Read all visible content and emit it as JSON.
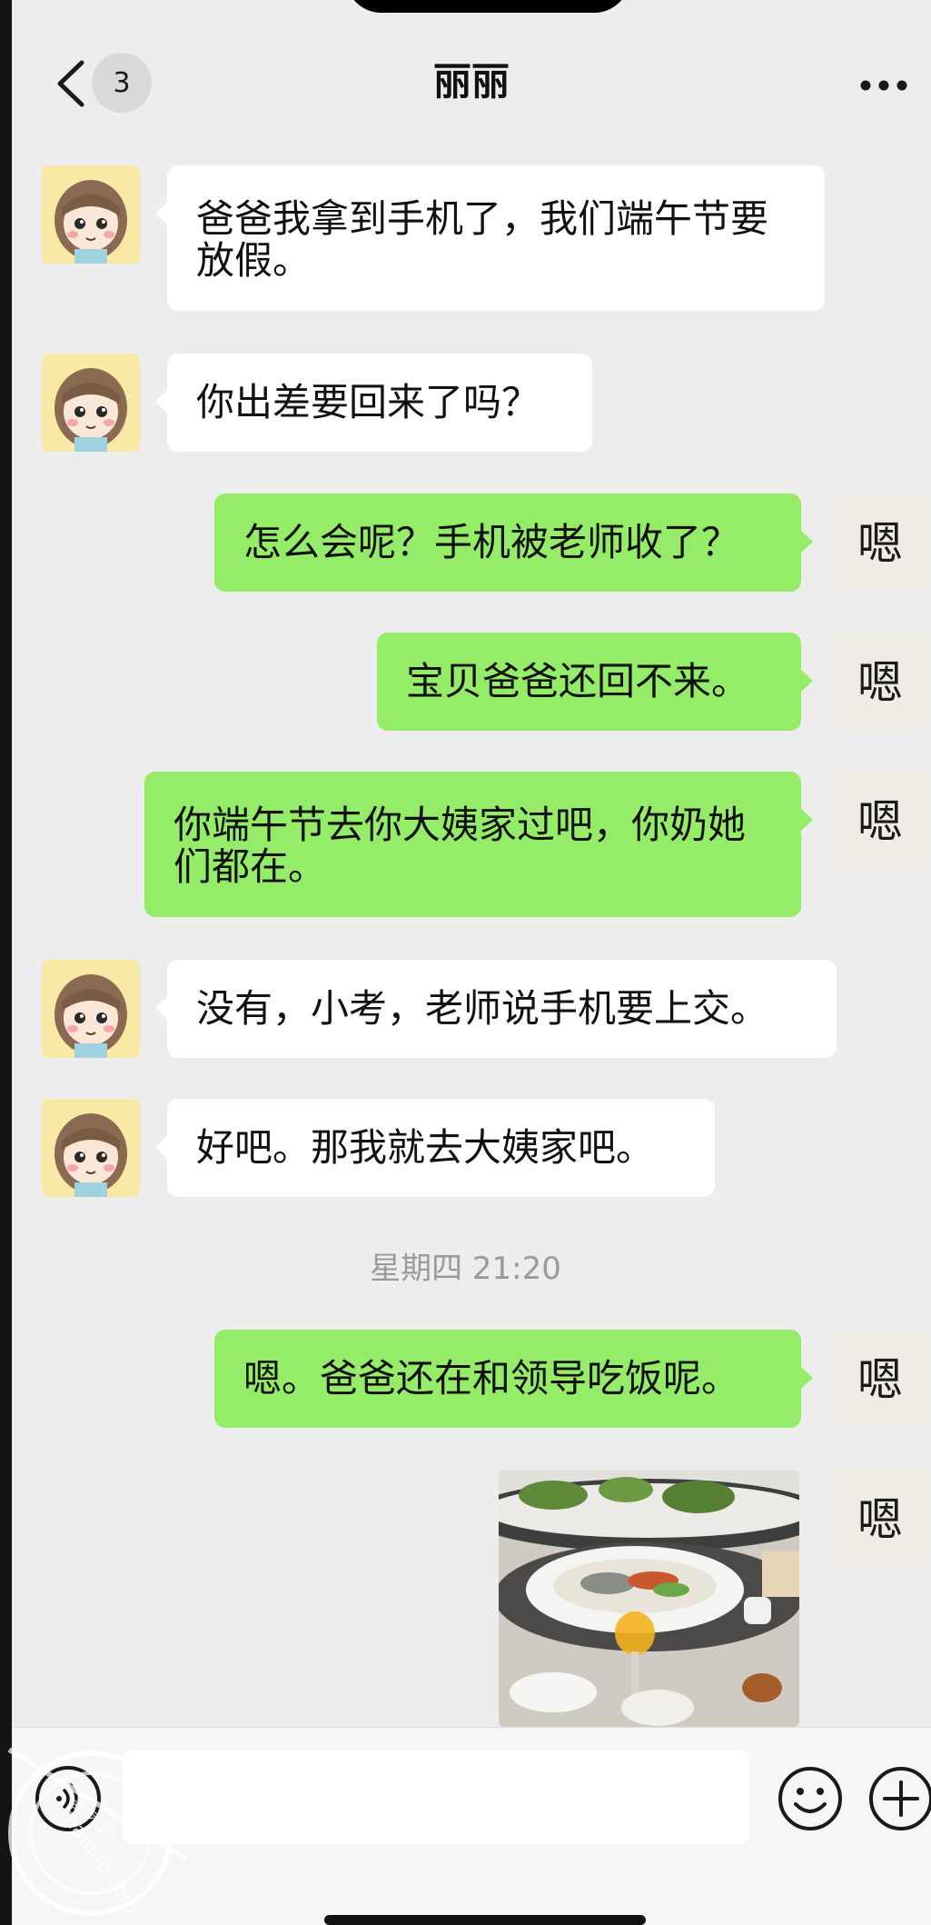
{
  "header": {
    "back_label": "back",
    "unread_count": "3",
    "title": "丽丽",
    "more_label": "more"
  },
  "messages": [
    {
      "side": "in",
      "lines": [
        "爸爸我拿到手机了，我们端午节要",
        "放假。"
      ]
    },
    {
      "side": "in",
      "lines": [
        "你出差要回来了吗？"
      ]
    },
    {
      "side": "out",
      "lines": [
        "怎么会呢？手机被老师收了？"
      ]
    },
    {
      "side": "out",
      "lines": [
        "宝贝爸爸还回不来。"
      ]
    },
    {
      "side": "out",
      "lines": [
        "你端午节去你大姨家过吧，你奶她",
        "们都在。"
      ]
    },
    {
      "side": "in",
      "lines": [
        "没有，小考，老师说手机要上交。"
      ]
    },
    {
      "side": "in",
      "lines": [
        "好吧。那我就去大姨家吧。"
      ]
    },
    {
      "side": "out",
      "lines": [
        "嗯。爸爸还在和领导吃饭呢。"
      ]
    }
  ],
  "timestamp": "星期四 21:20",
  "photo_message": {
    "side": "out",
    "description_icon": "food-photo"
  },
  "my_avatar_glyph": "嗯",
  "input": {
    "value": "",
    "placeholder": ""
  },
  "watermark": {
    "line1": "麦步社区",
    "line2": "maibao.com"
  },
  "colors": {
    "background": "#ededed",
    "incoming_bubble": "#ffffff",
    "outgoing_bubble": "#95ec69",
    "timestamp_text": "#9a9a9a"
  },
  "icons": {
    "back": "chevron-left-icon",
    "more": "more-dots-icon",
    "voice": "voice-icon",
    "emoji": "emoji-icon",
    "plus": "plus-icon"
  }
}
